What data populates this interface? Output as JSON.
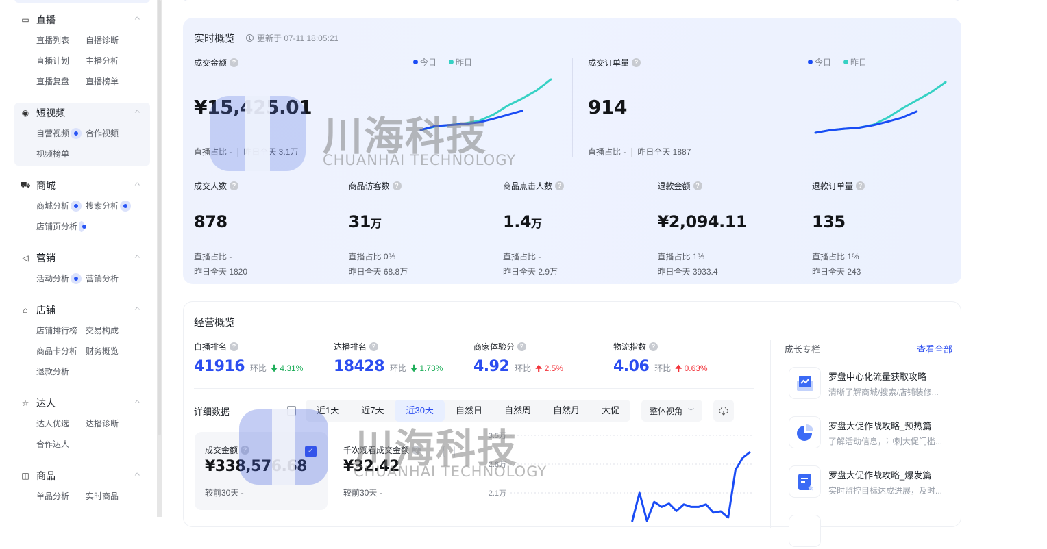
{
  "sidebar": {
    "groups": [
      {
        "title": "直播",
        "icon": "live-icon",
        "items": [
          {
            "label": "直播列表",
            "dot": false
          },
          {
            "label": "自播诊断",
            "dot": false
          },
          {
            "label": "直播计划",
            "dot": false
          },
          {
            "label": "主播分析",
            "dot": false
          },
          {
            "label": "直播复盘",
            "dot": false
          },
          {
            "label": "直播榜单",
            "dot": false
          }
        ]
      },
      {
        "title": "短视频",
        "icon": "video-icon",
        "active": true,
        "items": [
          {
            "label": "自营视频",
            "dot": true
          },
          {
            "label": "合作视频",
            "dot": false
          },
          {
            "label": "视频榜单",
            "dot": false
          }
        ]
      },
      {
        "title": "商城",
        "icon": "cart-icon",
        "items": [
          {
            "label": "商城分析",
            "dot": true
          },
          {
            "label": "搜索分析",
            "dot": true
          },
          {
            "label": "店铺页分析",
            "dot": true
          }
        ]
      },
      {
        "title": "营销",
        "icon": "megaphone-icon",
        "items": [
          {
            "label": "活动分析",
            "dot": true
          },
          {
            "label": "营销分析",
            "dot": false
          }
        ]
      },
      {
        "title": "店铺",
        "icon": "store-icon",
        "items": [
          {
            "label": "店铺排行榜",
            "dot": false
          },
          {
            "label": "交易构成",
            "dot": false
          },
          {
            "label": "商品卡分析",
            "dot": false
          },
          {
            "label": "财务概览",
            "dot": false
          },
          {
            "label": "退款分析",
            "dot": false
          }
        ]
      },
      {
        "title": "达人",
        "icon": "star-icon",
        "items": [
          {
            "label": "达人优选",
            "dot": false
          },
          {
            "label": "达播诊断",
            "dot": false
          },
          {
            "label": "合作达人",
            "dot": false
          }
        ]
      },
      {
        "title": "商品",
        "icon": "bag-icon",
        "items": [
          {
            "label": "单品分析",
            "dot": false
          },
          {
            "label": "实时商品",
            "dot": false
          }
        ]
      }
    ]
  },
  "realtime": {
    "title": "实时概览",
    "updated": "更新于 07-11 18:05:21",
    "legend": {
      "today": "今日",
      "yesterday": "昨日",
      "today_color": "#1a4cf5",
      "yesterday_color": "#36d1c4"
    },
    "gmv": {
      "label": "成交金额",
      "value": "¥15,425.01",
      "live_ratio": "直播占比 -",
      "yesterday_total": "昨日全天 3.1万",
      "spark_today": [
        0.0,
        0.08,
        0.1,
        0.12,
        0.15,
        0.22,
        0.3,
        0.38
      ],
      "spark_yesterday": [
        0.0,
        0.07,
        0.1,
        0.13,
        0.18,
        0.3,
        0.48,
        0.62,
        0.78,
        1.0
      ]
    },
    "orders": {
      "label": "成交订单量",
      "value": "914",
      "live_ratio": "直播占比 -",
      "yesterday_total": "昨日全天 1887",
      "spark_today": [
        0.0,
        0.05,
        0.08,
        0.1,
        0.15,
        0.22,
        0.3,
        0.42
      ],
      "spark_yesterday": [
        0.0,
        0.05,
        0.08,
        0.1,
        0.16,
        0.3,
        0.48,
        0.64,
        0.8,
        1.0
      ]
    },
    "kpis": [
      {
        "label": "成交人数",
        "value": "878",
        "unit": "",
        "line1": "直播占比 -",
        "line2": "昨日全天 1820"
      },
      {
        "label": "商品访客数",
        "value": "31",
        "unit": "万",
        "line1": "直播占比 0%",
        "line2": "昨日全天 68.8万"
      },
      {
        "label": "商品点击人数",
        "value": "1.4",
        "unit": "万",
        "line1": "直播占比 -",
        "line2": "昨日全天 2.9万"
      },
      {
        "label": "退款金额",
        "value": "¥2,094.11",
        "unit": "",
        "line1": "直播占比 1%",
        "line2": "昨日全天 3933.4"
      },
      {
        "label": "退款订单量",
        "value": "135",
        "unit": "",
        "line1": "直播占比 1%",
        "line2": "昨日全天 243"
      }
    ]
  },
  "business": {
    "title": "经营概览",
    "ranks": [
      {
        "label": "自播排名",
        "value": "41916",
        "cmp_label": "环比",
        "change": "4.31%",
        "dir": "down"
      },
      {
        "label": "达播排名",
        "value": "18428",
        "cmp_label": "环比",
        "change": "1.73%",
        "dir": "down"
      },
      {
        "label": "商家体验分",
        "value": "4.92",
        "cmp_label": "环比",
        "change": "2.5%",
        "dir": "up"
      },
      {
        "label": "物流指数",
        "value": "4.06",
        "cmp_label": "环比",
        "change": "0.63%",
        "dir": "up"
      }
    ],
    "detail_title": "详细数据",
    "tabs": [
      "近1天",
      "近7天",
      "近30天",
      "自然日",
      "自然周",
      "自然月",
      "大促"
    ],
    "active_tab": 2,
    "view_select": "整体视角",
    "metric_cards": [
      {
        "label": "成交金额",
        "value": "¥338,576.68",
        "cmp": "较前30天 -",
        "checked": true
      },
      {
        "label": "千次观看成交金额",
        "value": "¥32.42",
        "cmp": "较前30天 -",
        "checked": false
      }
    ],
    "growth": {
      "title": "成长专栏",
      "view_all": "查看全部",
      "items": [
        {
          "title": "罗盘中心化流量获取攻略",
          "desc": "清晰了解商城/搜索/店铺装修...",
          "icon": "trend-chart-icon"
        },
        {
          "title": "罗盘大促作战攻略_预热篇",
          "desc": "了解活动信息，冲刺大促门槛...",
          "icon": "pie-chart-icon"
        },
        {
          "title": "罗盘大促作战攻略_爆发篇",
          "desc": "实时监控目标达成进展，及时...",
          "icon": "document-star-icon"
        }
      ]
    }
  },
  "chart_data": {
    "type": "line",
    "title": "",
    "yticks": [
      "3.5万",
      "2.8万",
      "2.1万"
    ],
    "ylim": [
      14000,
      35000
    ],
    "series": [
      {
        "name": "成交金额",
        "color": "#1a4cf5",
        "values": [
          null,
          null,
          null,
          null,
          null,
          null,
          null,
          null,
          null,
          null,
          null,
          null,
          null,
          null,
          null,
          null,
          14000,
          21000,
          14200,
          18800,
          17600,
          18400,
          16600,
          18200,
          17600,
          17600,
          18200,
          16200,
          16500,
          15000,
          26600,
          29600,
          31000
        ]
      }
    ]
  },
  "watermark": {
    "cn": "川海科技",
    "en": "CHUANHAI TECHNOLOGY"
  }
}
